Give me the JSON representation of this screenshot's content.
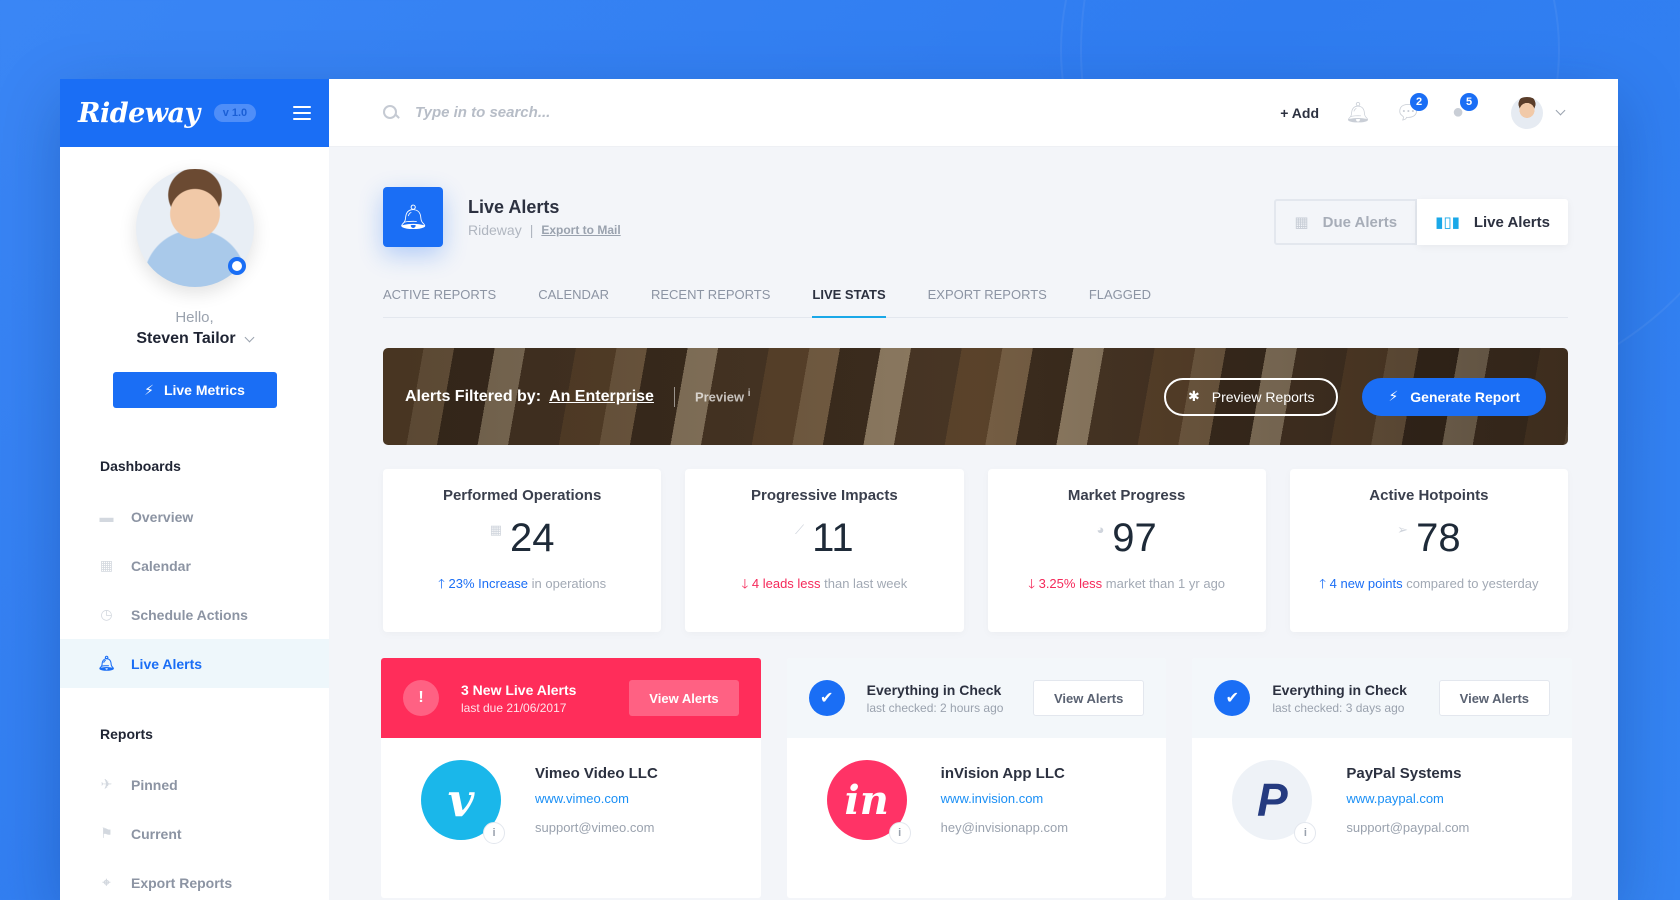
{
  "brand": {
    "name": "Rideway",
    "version": "v 1.0"
  },
  "search": {
    "placeholder": "Type in to search..."
  },
  "topbar": {
    "add_label": "+ Add",
    "messages_count": "2",
    "notifications_count": "5"
  },
  "profile": {
    "greeting": "Hello,",
    "name": "Steven Tailor",
    "cta": "Live Metrics"
  },
  "sidebar": {
    "dashboards_title": "Dashboards",
    "dashboards": [
      {
        "label": "Overview",
        "icon": "overview-icon"
      },
      {
        "label": "Calendar",
        "icon": "calendar-icon"
      },
      {
        "label": "Schedule Actions",
        "icon": "clock-icon"
      },
      {
        "label": "Live Alerts",
        "icon": "bell-icon",
        "active": true
      }
    ],
    "reports_title": "Reports",
    "reports": [
      {
        "label": "Pinned",
        "icon": "pin-icon"
      },
      {
        "label": "Current",
        "icon": "flag-icon"
      },
      {
        "label": "Export Reports",
        "icon": "location-icon"
      }
    ]
  },
  "page": {
    "title": "Live Alerts",
    "subtitle": "Rideway",
    "sub_sep": "|",
    "export_link": "Export to Mail",
    "toggle": {
      "due": "Due Alerts",
      "live": "Live Alerts"
    }
  },
  "tabs": [
    {
      "label": "ACTIVE REPORTS"
    },
    {
      "label": "CALENDAR"
    },
    {
      "label": "RECENT REPORTS"
    },
    {
      "label": "LIVE STATS",
      "active": true
    },
    {
      "label": "EXPORT REPORTS"
    },
    {
      "label": "FLAGGED"
    }
  ],
  "banner": {
    "label": "Alerts Filtered by:",
    "value": "An Enterprise",
    "preview": "Preview",
    "preview_info": "i",
    "preview_reports": "Preview Reports",
    "generate_report": "Generate Report"
  },
  "stats": [
    {
      "title": "Performed Operations",
      "value": "24",
      "icon": "briefcase-icon",
      "trend": "up",
      "highlight": "23% Increase",
      "rest": " in operations"
    },
    {
      "title": "Progressive Impacts",
      "value": "11",
      "icon": "line-chart-icon",
      "trend": "down",
      "highlight": "4 leads less",
      "rest": "  than last week"
    },
    {
      "title": "Market Progress",
      "value": "97",
      "icon": "pie-chart-icon",
      "trend": "down",
      "highlight": "3.25% less",
      "rest": " market than 1 yr ago"
    },
    {
      "title": "Active Hotpoints",
      "value": "78",
      "icon": "paper-plane-icon",
      "trend": "up",
      "highlight": "4 new points",
      "rest": " compared to yesterday"
    }
  ],
  "alerts": [
    {
      "status": "danger",
      "badge": "!",
      "title": "3 New Live Alerts",
      "sub": "last due 21/06/2017",
      "button": "View Alerts",
      "company": {
        "name": "Vimeo Video LLC",
        "url": "www.vimeo.com",
        "email": "support@vimeo.com",
        "logo_text": "v",
        "color": "#1ab7ea"
      }
    },
    {
      "status": "ok",
      "badge": "✔",
      "title": "Everything in Check",
      "sub": "last checked: 2 hours ago",
      "button": "View Alerts",
      "company": {
        "name": "inVision App LLC",
        "url": "www.invision.com",
        "email": "hey@invisionapp.com",
        "logo_text": "in",
        "color": "#ff3366"
      }
    },
    {
      "status": "ok",
      "badge": "✔",
      "title": "Everything in Check",
      "sub": "last checked: 3 days ago",
      "button": "View Alerts",
      "company": {
        "name": "PayPal Systems",
        "url": "www.paypal.com",
        "email": "support@paypal.com",
        "logo_text": "P",
        "color": "#253b80"
      }
    }
  ],
  "colors": {
    "accent": "#1a6ef5",
    "danger": "#ff2d5a",
    "background": "#2f7cf0"
  }
}
